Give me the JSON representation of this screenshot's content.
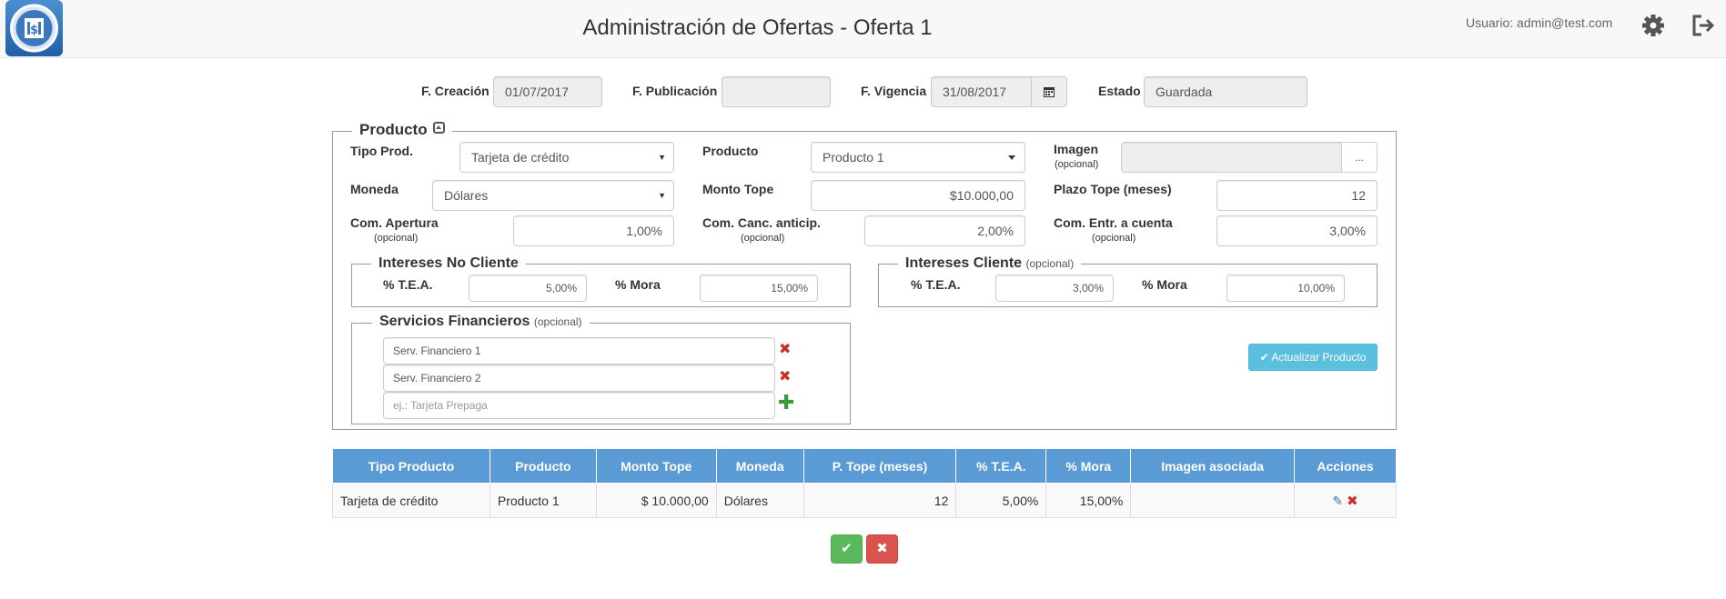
{
  "header": {
    "title": "Administración de Ofertas - Oferta 1",
    "user_label": "Usuario: admin@test.com",
    "logo_icon": "bank-icon",
    "settings_icon": "gear-icon",
    "logout_icon": "logout-icon"
  },
  "dates": {
    "creacion_label": "F. Creación",
    "creacion_value": "01/07/2017",
    "publicacion_label": "F. Publicación",
    "publicacion_value": "",
    "vigencia_label": "F. Vigencia",
    "vigencia_value": "31/08/2017",
    "estado_label": "Estado",
    "estado_value": "Guardada"
  },
  "producto": {
    "legend": "Producto",
    "tipo_prod_label": "Tipo Prod.",
    "tipo_prod_value": "Tarjeta de crédito",
    "producto_label": "Producto",
    "producto_value": "Producto 1",
    "imagen_label": "Imagen",
    "imagen_opt": "(opcional)",
    "imagen_value": "",
    "imagen_browse": "...",
    "moneda_label": "Moneda",
    "moneda_value": "Dólares",
    "monto_tope_label": "Monto Tope",
    "monto_tope_value": "$10.000,00",
    "plazo_tope_label": "Plazo Tope (meses)",
    "plazo_tope_value": "12",
    "com_apertura_label": "Com. Apertura",
    "com_apertura_opt": "(opcional)",
    "com_apertura_value": "1,00%",
    "com_canc_label": "Com. Canc. anticip.",
    "com_canc_opt": "(opcional)",
    "com_canc_value": "2,00%",
    "com_entr_label": "Com. Entr. a cuenta",
    "com_entr_opt": "(opcional)",
    "com_entr_value": "3,00%",
    "update_button": "Actualizar Producto"
  },
  "intereses_no_cliente": {
    "legend": "Intereses No Cliente",
    "tea_label": "% T.E.A.",
    "tea_value": "5,00%",
    "mora_label": "% Mora",
    "mora_value": "15,00%"
  },
  "intereses_cliente": {
    "legend": "Intereses Cliente",
    "legend_opt": "(opcional)",
    "tea_label": "% T.E.A.",
    "tea_value": "3,00%",
    "mora_label": "% Mora",
    "mora_value": "10,00%"
  },
  "servicios": {
    "legend": "Servicios Financieros",
    "legend_opt": "(opcional)",
    "items": [
      "Serv. Financiero 1",
      "Serv. Financiero 2"
    ],
    "new_placeholder": "ej.: Tarjeta Prepaga"
  },
  "table": {
    "headers": [
      "Tipo Producto",
      "Producto",
      "Monto Tope",
      "Moneda",
      "P. Tope (meses)",
      "% T.E.A.",
      "% Mora",
      "Imagen asociada",
      "Acciones"
    ],
    "rows": [
      [
        "Tarjeta de crédito",
        "Producto 1",
        "$ 10.000,00",
        "Dólares",
        "12",
        "5,00%",
        "15,00%",
        ""
      ]
    ]
  },
  "colors": {
    "table_header": "#5b9bd5",
    "update_button": "#5bc0de",
    "confirm": "#5cb85c",
    "cancel": "#d9534f"
  }
}
